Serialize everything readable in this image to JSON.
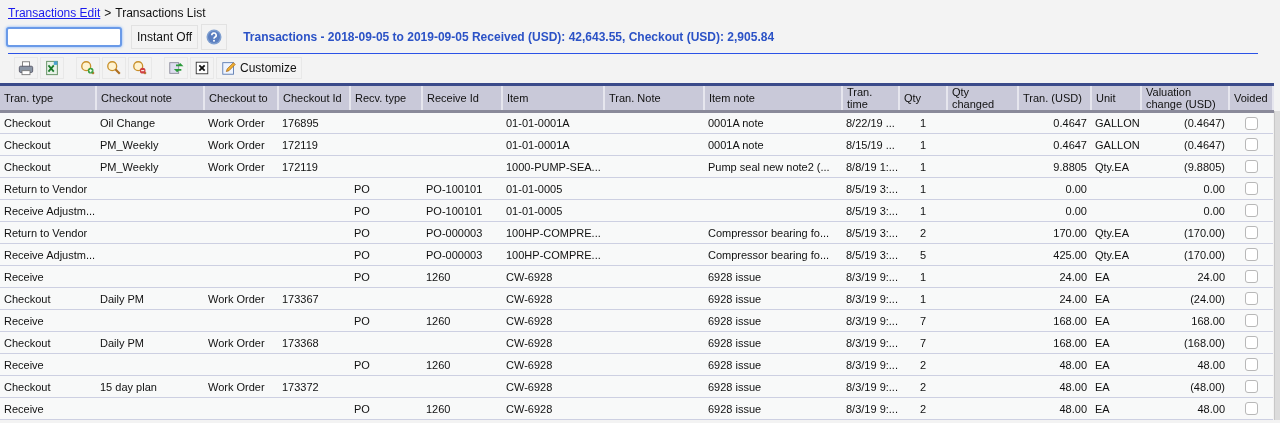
{
  "breadcrumb": {
    "link": "Transactions Edit",
    "separator": ">",
    "current": "Transactions List"
  },
  "instant_button": "Instant Off",
  "summary": "Transactions - 2018-09-05 to 2019-09-05 Received (USD): 42,643.55, Checkout (USD): 2,905.84",
  "toolbar": {
    "customize": "Customize"
  },
  "table": {
    "columns": [
      "Tran. type",
      "Checkout note",
      "Checkout to",
      "Checkout Id",
      "Recv. type",
      "Receive Id",
      "Item",
      "Tran. Note",
      "Item note",
      "Tran. time",
      "Qty",
      "Qty changed",
      "Tran. (USD)",
      "Unit",
      "Valuation change (USD)",
      "Voided"
    ],
    "rows": [
      {
        "tran_type": "Checkout",
        "checkout_note": "Oil Change",
        "checkout_to": "Work Order",
        "checkout_id": "176895",
        "item": "01-01-0001A",
        "item_note": "0001A note",
        "tran_time": "8/22/19 ...",
        "qty": "1",
        "tran_usd": "0.4647",
        "unit": "GALLON",
        "valuation_change": "(0.4647)",
        "voided": false
      },
      {
        "tran_type": "Checkout",
        "checkout_note": "PM_Weekly",
        "checkout_to": "Work Order",
        "checkout_id": "172119",
        "item": "01-01-0001A",
        "item_note": "0001A note",
        "tran_time": "8/15/19 ...",
        "qty": "1",
        "tran_usd": "0.4647",
        "unit": "GALLON",
        "valuation_change": "(0.4647)",
        "voided": false
      },
      {
        "tran_type": "Checkout",
        "checkout_note": "PM_Weekly",
        "checkout_to": "Work Order",
        "checkout_id": "172119",
        "item": "1000-PUMP-SEA...",
        "item_note": "Pump seal new note2 (...",
        "tran_time": "8/8/19 1:...",
        "qty": "1",
        "tran_usd": "9.8805",
        "unit": "Qty.EA",
        "valuation_change": "(9.8805)",
        "voided": false
      },
      {
        "tran_type": "Return to Vendor",
        "recv_type": "PO",
        "receive_id": "PO-100101",
        "item": "01-01-0005",
        "tran_time": "8/5/19 3:...",
        "qty": "1",
        "tran_usd": "0.00",
        "valuation_change": "0.00",
        "voided": false
      },
      {
        "tran_type": "Receive Adjustm...",
        "recv_type": "PO",
        "receive_id": "PO-100101",
        "item": "01-01-0005",
        "tran_time": "8/5/19 3:...",
        "qty": "1",
        "tran_usd": "0.00",
        "valuation_change": "0.00",
        "voided": false
      },
      {
        "tran_type": "Return to Vendor",
        "recv_type": "PO",
        "receive_id": "PO-000003",
        "item": "100HP-COMPRE...",
        "item_note": "Compressor bearing fo...",
        "tran_time": "8/5/19 3:...",
        "qty": "2",
        "tran_usd": "170.00",
        "unit": "Qty.EA",
        "valuation_change": "(170.00)",
        "voided": false
      },
      {
        "tran_type": "Receive Adjustm...",
        "recv_type": "PO",
        "receive_id": "PO-000003",
        "item": "100HP-COMPRE...",
        "item_note": "Compressor bearing fo...",
        "tran_time": "8/5/19 3:...",
        "qty": "5",
        "tran_usd": "425.00",
        "unit": "Qty.EA",
        "valuation_change": "(170.00)",
        "voided": false
      },
      {
        "tran_type": "Receive",
        "recv_type": "PO",
        "receive_id": "1260",
        "item": "CW-6928",
        "item_note": "6928 issue",
        "tran_time": "8/3/19 9:...",
        "qty": "1",
        "tran_usd": "24.00",
        "unit": "EA",
        "valuation_change": "24.00",
        "voided": false
      },
      {
        "tran_type": "Checkout",
        "checkout_note": "Daily PM",
        "checkout_to": "Work Order",
        "checkout_id": "173367",
        "item": "CW-6928",
        "item_note": "6928 issue",
        "tran_time": "8/3/19 9:...",
        "qty": "1",
        "tran_usd": "24.00",
        "unit": "EA",
        "valuation_change": "(24.00)",
        "voided": false
      },
      {
        "tran_type": "Receive",
        "recv_type": "PO",
        "receive_id": "1260",
        "item": "CW-6928",
        "item_note": "6928 issue",
        "tran_time": "8/3/19 9:...",
        "qty": "7",
        "tran_usd": "168.00",
        "unit": "EA",
        "valuation_change": "168.00",
        "voided": false
      },
      {
        "tran_type": "Checkout",
        "checkout_note": "Daily PM",
        "checkout_to": "Work Order",
        "checkout_id": "173368",
        "item": "CW-6928",
        "item_note": "6928 issue",
        "tran_time": "8/3/19 9:...",
        "qty": "7",
        "tran_usd": "168.00",
        "unit": "EA",
        "valuation_change": "(168.00)",
        "voided": false
      },
      {
        "tran_type": "Receive",
        "recv_type": "PO",
        "receive_id": "1260",
        "item": "CW-6928",
        "item_note": "6928 issue",
        "tran_time": "8/3/19 9:...",
        "qty": "2",
        "tran_usd": "48.00",
        "unit": "EA",
        "valuation_change": "48.00",
        "voided": false
      },
      {
        "tran_type": "Checkout",
        "checkout_note": "15 day plan",
        "checkout_to": "Work Order",
        "checkout_id": "173372",
        "item": "CW-6928",
        "item_note": "6928 issue",
        "tran_time": "8/3/19 9:...",
        "qty": "2",
        "tran_usd": "48.00",
        "unit": "EA",
        "valuation_change": "(48.00)",
        "voided": false
      },
      {
        "tran_type": "Receive",
        "recv_type": "PO",
        "receive_id": "1260",
        "item": "CW-6928",
        "item_note": "6928 issue",
        "tran_time": "8/3/19 9:...",
        "qty": "2",
        "tran_usd": "48.00",
        "unit": "EA",
        "valuation_change": "48.00",
        "voided": false
      }
    ]
  }
}
